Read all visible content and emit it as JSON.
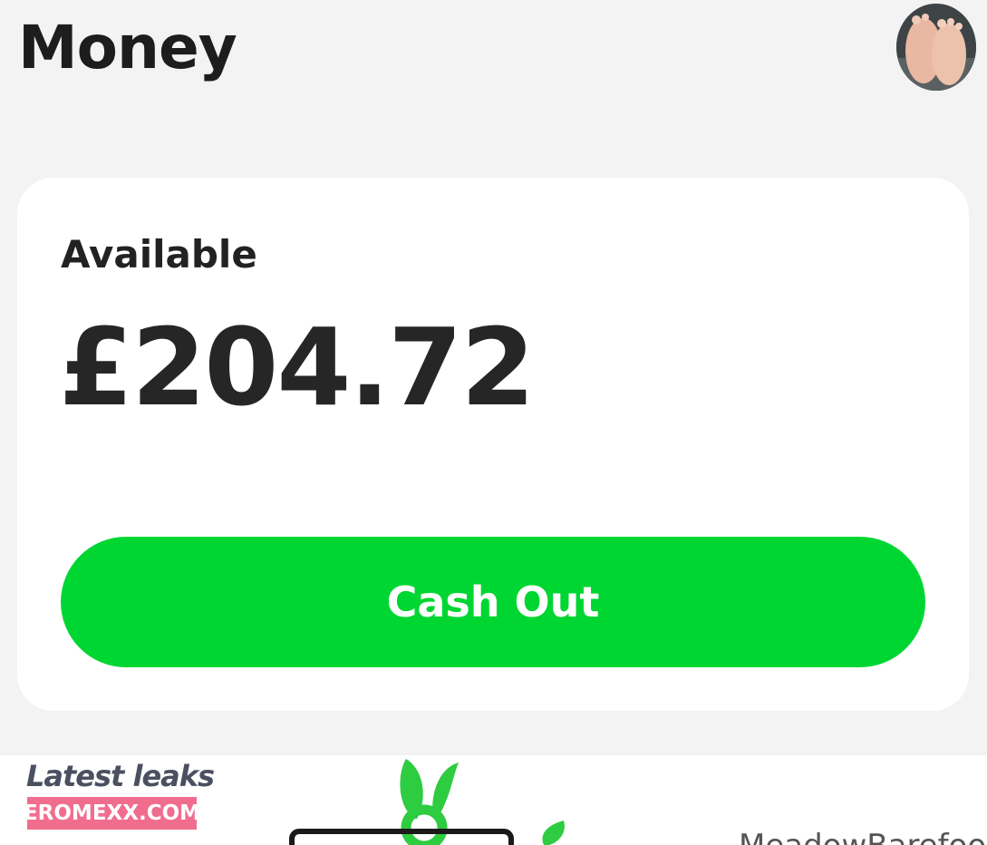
{
  "header": {
    "title": "Money"
  },
  "profile": {
    "avatar_icon": "user-avatar-photo"
  },
  "balance": {
    "label": "Available",
    "amount": "£204.72"
  },
  "actions": {
    "cash_out_label": "Cash Out"
  },
  "watermark": {
    "title": "Latest leaks",
    "site": "EROMEXX.COM"
  },
  "footer": {
    "username": "MeadowBarefoot"
  },
  "colors": {
    "accent": "#00d632",
    "background": "#f3f3f3",
    "card": "#ffffff",
    "text": "#1d1d1d"
  }
}
